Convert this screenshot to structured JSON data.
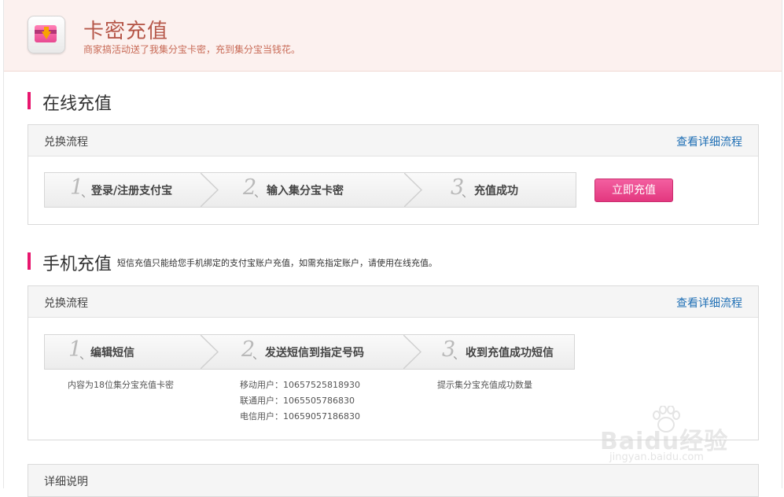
{
  "header": {
    "title": "卡密充值",
    "subtitle": "商家搞活动送了我集分宝卡密，充到集分宝当钱花。",
    "icon": "card-download-icon"
  },
  "online": {
    "title": "在线充值",
    "panel_label": "兑换流程",
    "detail_link": "查看详细流程",
    "steps": [
      {
        "num": "1",
        "text": "登录/注册支付宝"
      },
      {
        "num": "2",
        "text": "输入集分宝卡密"
      },
      {
        "num": "3",
        "text": "充值成功"
      }
    ],
    "button": "立即充值"
  },
  "mobile": {
    "title": "手机充值",
    "note": "短信充值只能给您手机绑定的支付宝账户充值，如需充指定账户，请使用在线充值。",
    "panel_label": "兑换流程",
    "detail_link": "查看详细流程",
    "steps": [
      {
        "num": "1",
        "text": "编辑短信"
      },
      {
        "num": "2",
        "text": "发送短信到指定号码"
      },
      {
        "num": "3",
        "text": "收到充值成功短信"
      }
    ],
    "step1_desc": "内容为18位集分宝充值卡密",
    "step2_desc": [
      "移动用户：10657525818930",
      "联通用户：1065505786830",
      "电信用户：10659057186830"
    ],
    "step3_desc": "提示集分宝充值成功数量"
  },
  "details": {
    "label": "详细说明"
  },
  "watermark": {
    "brand": "Baidu经验",
    "url": "jingyan.baidu.com"
  },
  "colors": {
    "accent": "#e8166e",
    "link": "#1f6fb5",
    "title": "#b6584a",
    "header_bg": "#fcf1ef"
  }
}
